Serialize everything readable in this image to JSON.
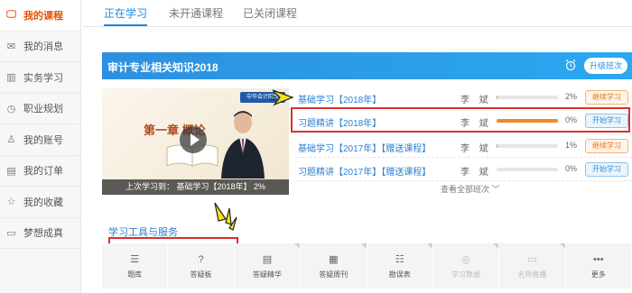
{
  "sidebar": {
    "items": [
      {
        "label": "我的课程",
        "icon": "monitor-icon",
        "active": true
      },
      {
        "label": "我的消息",
        "icon": "envelope-icon",
        "active": false
      },
      {
        "label": "实务学习",
        "icon": "book-icon",
        "active": false
      },
      {
        "label": "职业规划",
        "icon": "clock-icon",
        "active": false
      },
      {
        "label": "我的账号",
        "icon": "user-icon",
        "active": false
      },
      {
        "label": "我的订单",
        "icon": "document-icon",
        "active": false
      },
      {
        "label": "我的收藏",
        "icon": "star-icon",
        "active": false
      },
      {
        "label": "梦想成真",
        "icon": "open-book-icon",
        "active": false
      }
    ]
  },
  "tabs": [
    {
      "label": "正在学习",
      "active": true
    },
    {
      "label": "未开通课程",
      "active": false
    },
    {
      "label": "已关闭课程",
      "active": false
    }
  ],
  "course": {
    "title": "审计专业相关知识2018",
    "upgrade_label": "升级班次",
    "video": {
      "logo_text": "中华会计网校",
      "chapter_text": "第一章  概论",
      "last_study": "上次学习到： 基础学习【2018年】 2%"
    },
    "rows": [
      {
        "name": "基础学习【2018年】",
        "teacher": "李 斌",
        "progress": 2,
        "pct_label": "2%",
        "action": "继续学习",
        "action_type": "continue"
      },
      {
        "name": "习题精讲【2018年】",
        "teacher": "李 斌",
        "progress": 100,
        "pct_label": "0%",
        "action": "开始学习",
        "action_type": "start"
      },
      {
        "name": "基础学习【2017年】【赠送课程】",
        "teacher": "李 斌",
        "progress": 1,
        "pct_label": "1%",
        "action": "继续学习",
        "action_type": "continue"
      },
      {
        "name": "习题精讲【2017年】【赠送课程】",
        "teacher": "李 斌",
        "progress": 0,
        "pct_label": "0%",
        "action": "开始学习",
        "action_type": "start"
      }
    ],
    "see_all": "查看全部班次 ﹀"
  },
  "tools": {
    "title": "学习工具与服务",
    "items": [
      {
        "label": "题库",
        "icon": "list-icon",
        "glyph": "☰",
        "disabled": false
      },
      {
        "label": "答疑板",
        "icon": "question-icon",
        "glyph": "?",
        "disabled": false
      },
      {
        "label": "答疑精华",
        "icon": "essence-icon",
        "glyph": "▤",
        "disabled": false
      },
      {
        "label": "答疑周刊",
        "icon": "weekly-icon",
        "glyph": "▦",
        "disabled": false
      },
      {
        "label": "勘误表",
        "icon": "errata-icon",
        "glyph": "☷",
        "disabled": false
      },
      {
        "label": "学习数据",
        "icon": "data-icon",
        "glyph": "◎",
        "disabled": true
      },
      {
        "label": "名师直播",
        "icon": "live-icon",
        "glyph": "▭",
        "disabled": true
      },
      {
        "label": "更多",
        "icon": "more-icon",
        "glyph": "•••",
        "disabled": false
      }
    ]
  },
  "colors": {
    "accent": "#1e88e5",
    "active_orange": "#e65100",
    "progress": "#f08a24",
    "highlight": "#d9302b",
    "burst": "#f6e11a"
  }
}
